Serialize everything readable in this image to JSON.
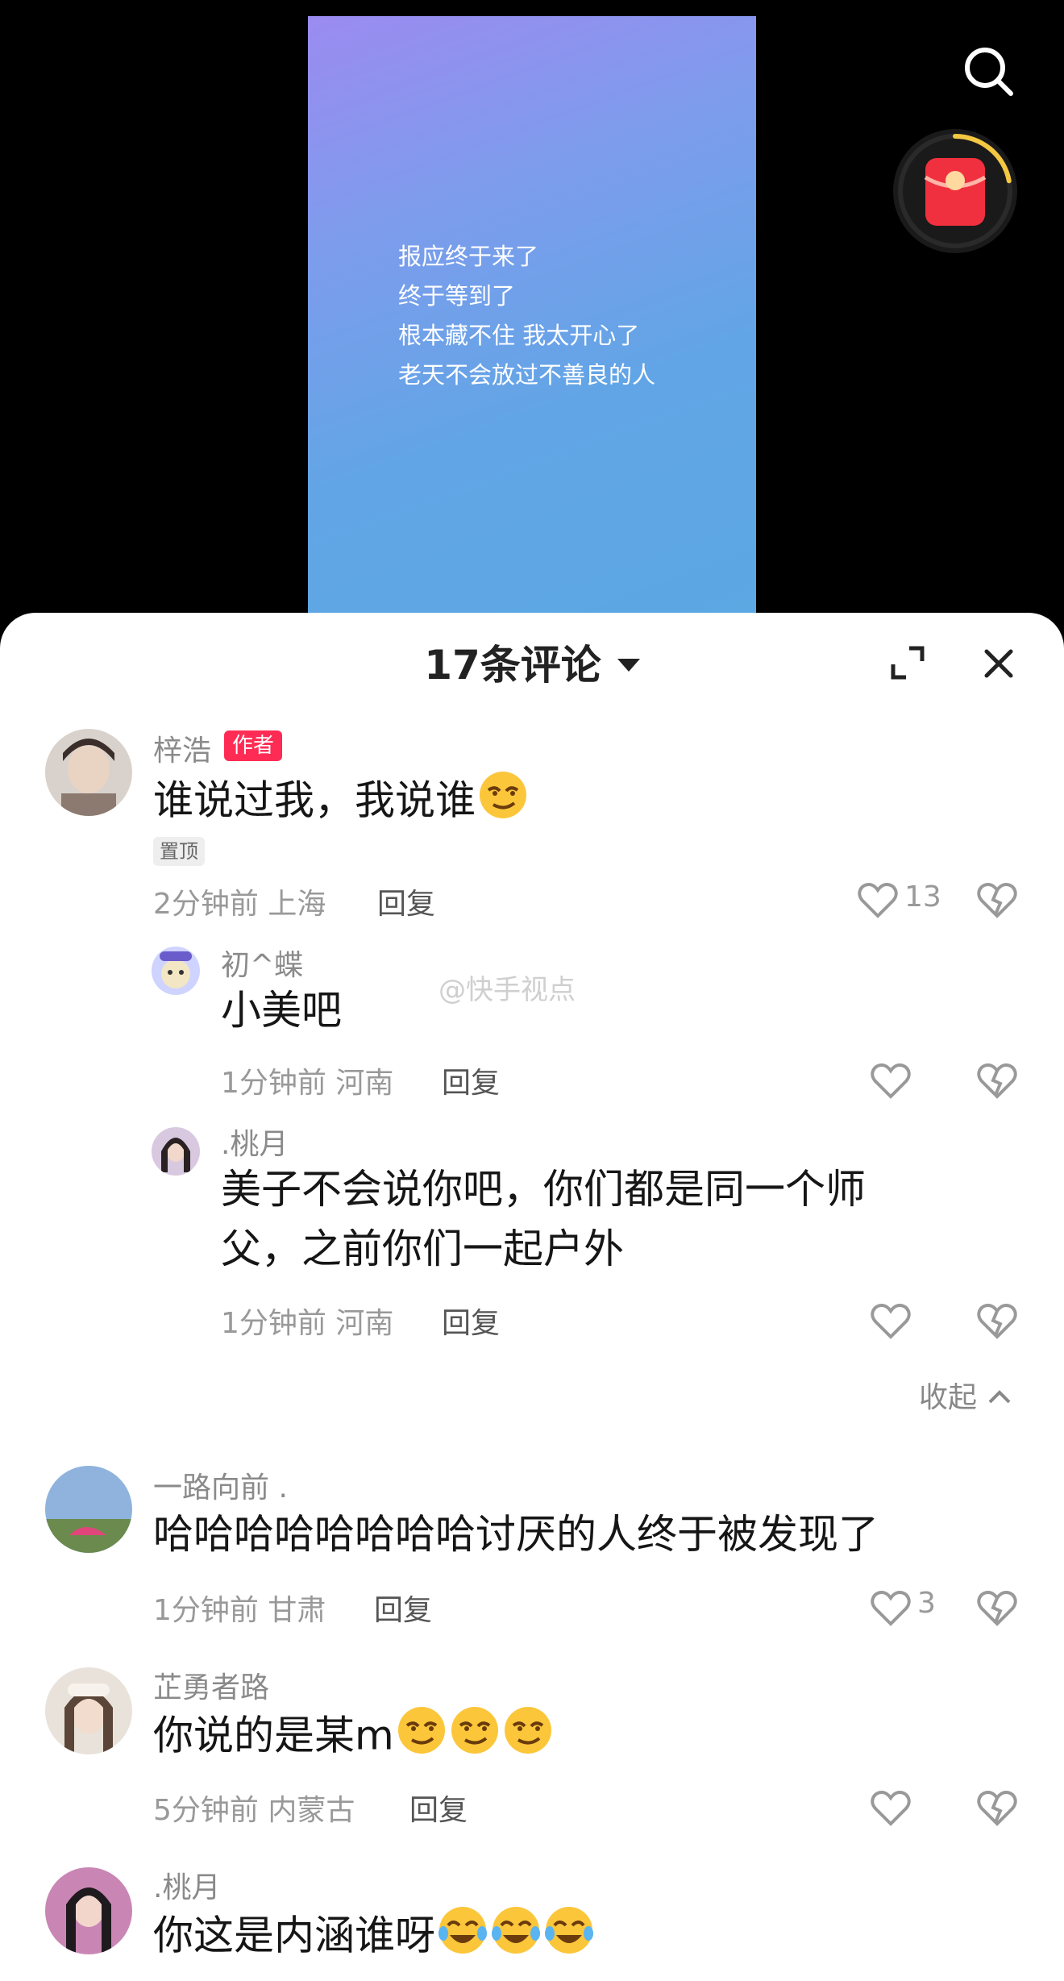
{
  "video": {
    "lines": [
      "报应终于来了",
      "终于等到了",
      "根本藏不住 我太开心了",
      "老天不会放过不善良的人"
    ]
  },
  "icons": {
    "search": "search-icon",
    "redpacket": "red-envelope-icon",
    "expand": "expand-icon",
    "close": "close-icon",
    "like": "heart-icon",
    "dislike": "broken-heart-icon",
    "collapse": "chevron-up-icon"
  },
  "colors": {
    "accent": "#fe2c55",
    "progress_ring": "#f5c842",
    "redpack": "#f0303e"
  },
  "redpacket_progress": 0.22,
  "sheet": {
    "title": "17条评论"
  },
  "watermark": "@快手视点",
  "comments": [
    {
      "user": "梓浩",
      "badge": "作者",
      "text": "谁说过我，我说谁",
      "emoji_count": 1,
      "pinned": "置顶",
      "time": "2分钟前",
      "location": "上海",
      "reply": "回复",
      "likes": "13",
      "replies": [
        {
          "user": "初^蝶",
          "text": "小美吧",
          "time": "1分钟前",
          "location": "河南",
          "reply": "回复"
        },
        {
          "user": ".桃月",
          "text_line1": "美子不会说你吧，你们都是同一个师",
          "text_line2": "父，之前你们一起户外",
          "time": "1分钟前",
          "location": "河南",
          "reply": "回复"
        }
      ],
      "collapse_label": "收起"
    },
    {
      "user": "一路向前 .",
      "text": "哈哈哈哈哈哈哈哈讨厌的人终于被发现了",
      "time": "1分钟前",
      "location": "甘肃",
      "reply": "回复",
      "likes": "3"
    },
    {
      "user": "芷勇者路",
      "text": "你说的是某m",
      "emoji_count": 3,
      "time": "5分钟前",
      "location": "内蒙古",
      "reply": "回复"
    },
    {
      "user": ".桃月",
      "text": "你这是内涵谁呀",
      "emoji_count": 3
    }
  ]
}
